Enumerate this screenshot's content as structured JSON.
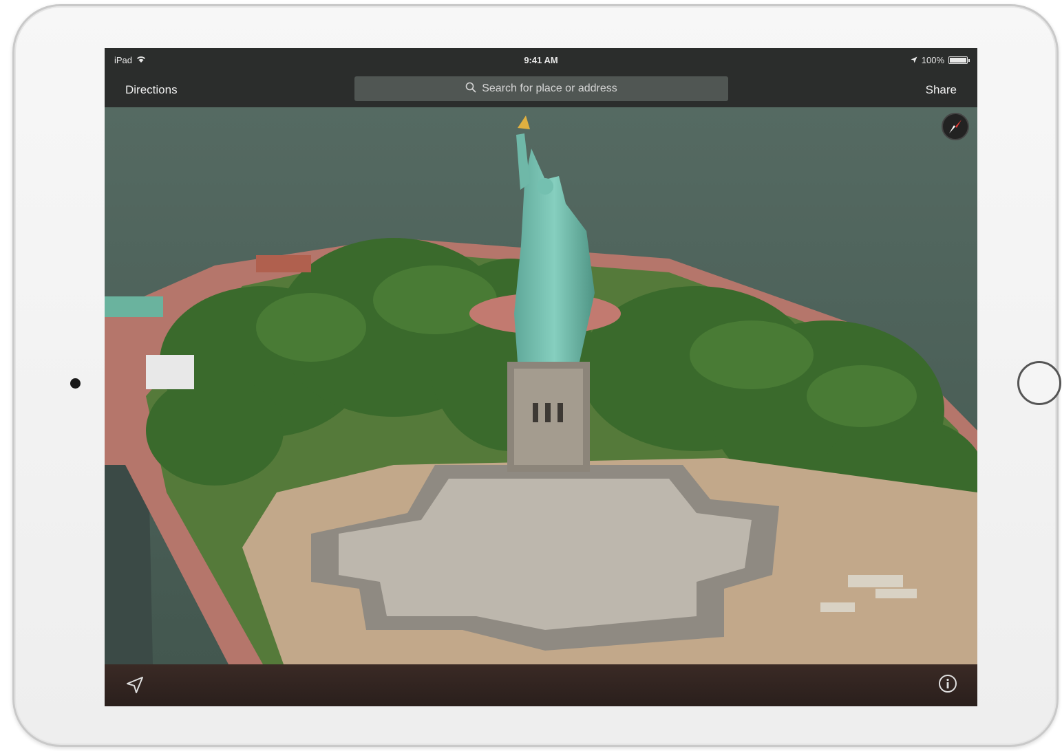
{
  "status_bar": {
    "device": "iPad",
    "time": "9:41 AM",
    "battery": "100%",
    "battery_level": 1.0
  },
  "nav": {
    "directions_label": "Directions",
    "search_placeholder": "Search for place or address",
    "share_label": "Share"
  },
  "map": {
    "view": "Flyover 3D",
    "colors": {
      "water": "#4a6058",
      "trees": "#3c6a2e",
      "statue": "#6fb8a8",
      "walkway": "#c27a70"
    }
  },
  "icons": [
    "wifi-icon",
    "location-arrow-icon",
    "search-icon",
    "compass-icon",
    "tracking-icon",
    "info-icon"
  ]
}
